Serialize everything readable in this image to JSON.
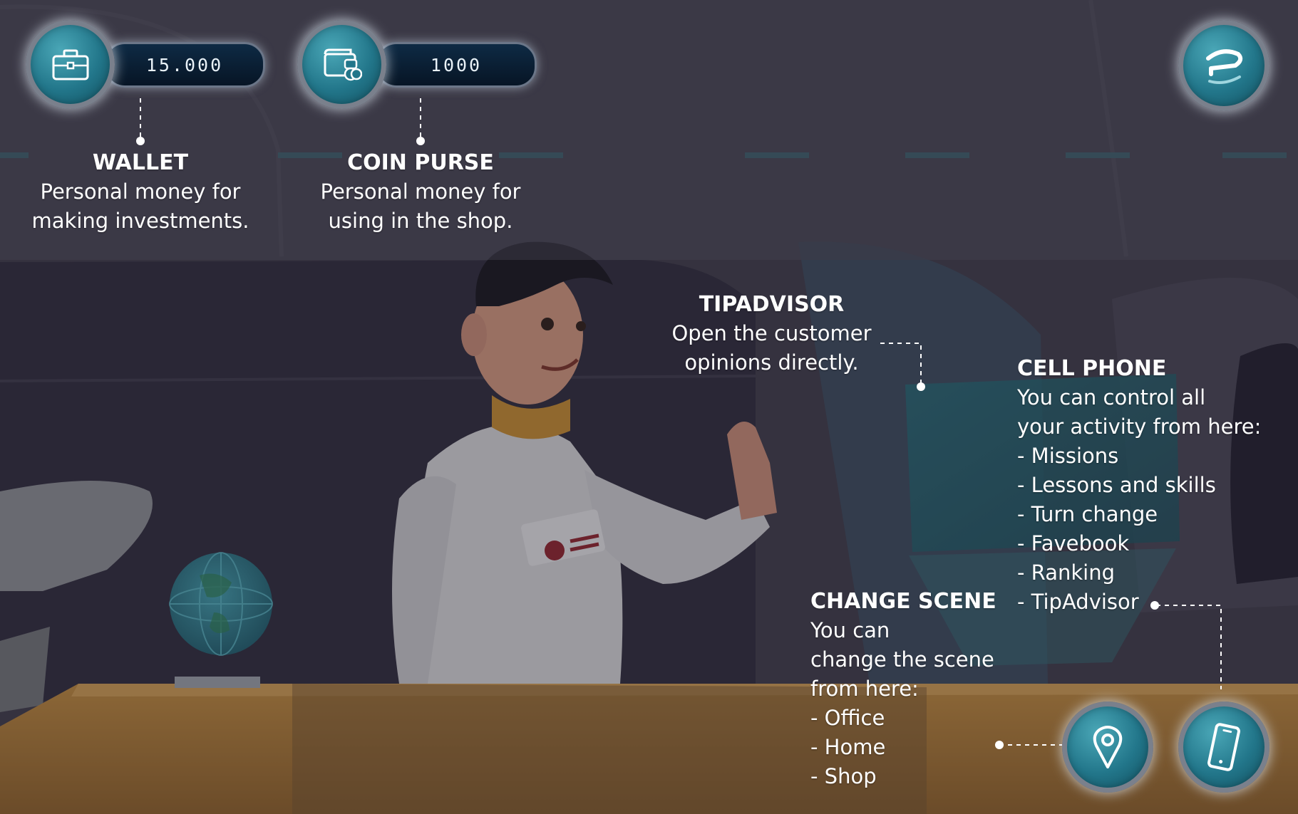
{
  "hud": {
    "wallet": {
      "value": "15.000",
      "icon": "briefcase-icon"
    },
    "coin_purse": {
      "value": "1000",
      "icon": "wallet-coins-icon"
    },
    "logo": {
      "icon": "tipadvisor-logo-icon"
    },
    "change_scene_button": {
      "icon": "map-pin-icon"
    },
    "cell_phone_button": {
      "icon": "smartphone-icon"
    }
  },
  "annotations": {
    "wallet": {
      "title": "WALLET",
      "lines": [
        "Personal money for",
        "making investments."
      ]
    },
    "coin_purse": {
      "title": "COIN PURSE",
      "lines": [
        "Personal money for",
        "using in the shop."
      ]
    },
    "tipadvisor": {
      "title": "TIPADVISOR",
      "lines": [
        "Open the customer",
        "opinions directly."
      ]
    },
    "cell_phone": {
      "title": "CELL PHONE",
      "lines": [
        "You can control all",
        "your activity from here:"
      ],
      "items": [
        "- Missions",
        "- Lessons and skills",
        "- Turn change",
        "- Favebook",
        "- Ranking",
        "- TipAdvisor"
      ]
    },
    "change_scene": {
      "title": "CHANGE SCENE",
      "lines": [
        "You can",
        "change the scene",
        "from here:"
      ],
      "items": [
        "- Office",
        "- Home",
        "- Shop"
      ]
    }
  },
  "colors": {
    "overlay": "#3d3a47",
    "orb_teal": "#22768a",
    "hud_pill": "#0b2036",
    "desk_orange": "#b0782c",
    "suit": "#dcdcdc"
  }
}
